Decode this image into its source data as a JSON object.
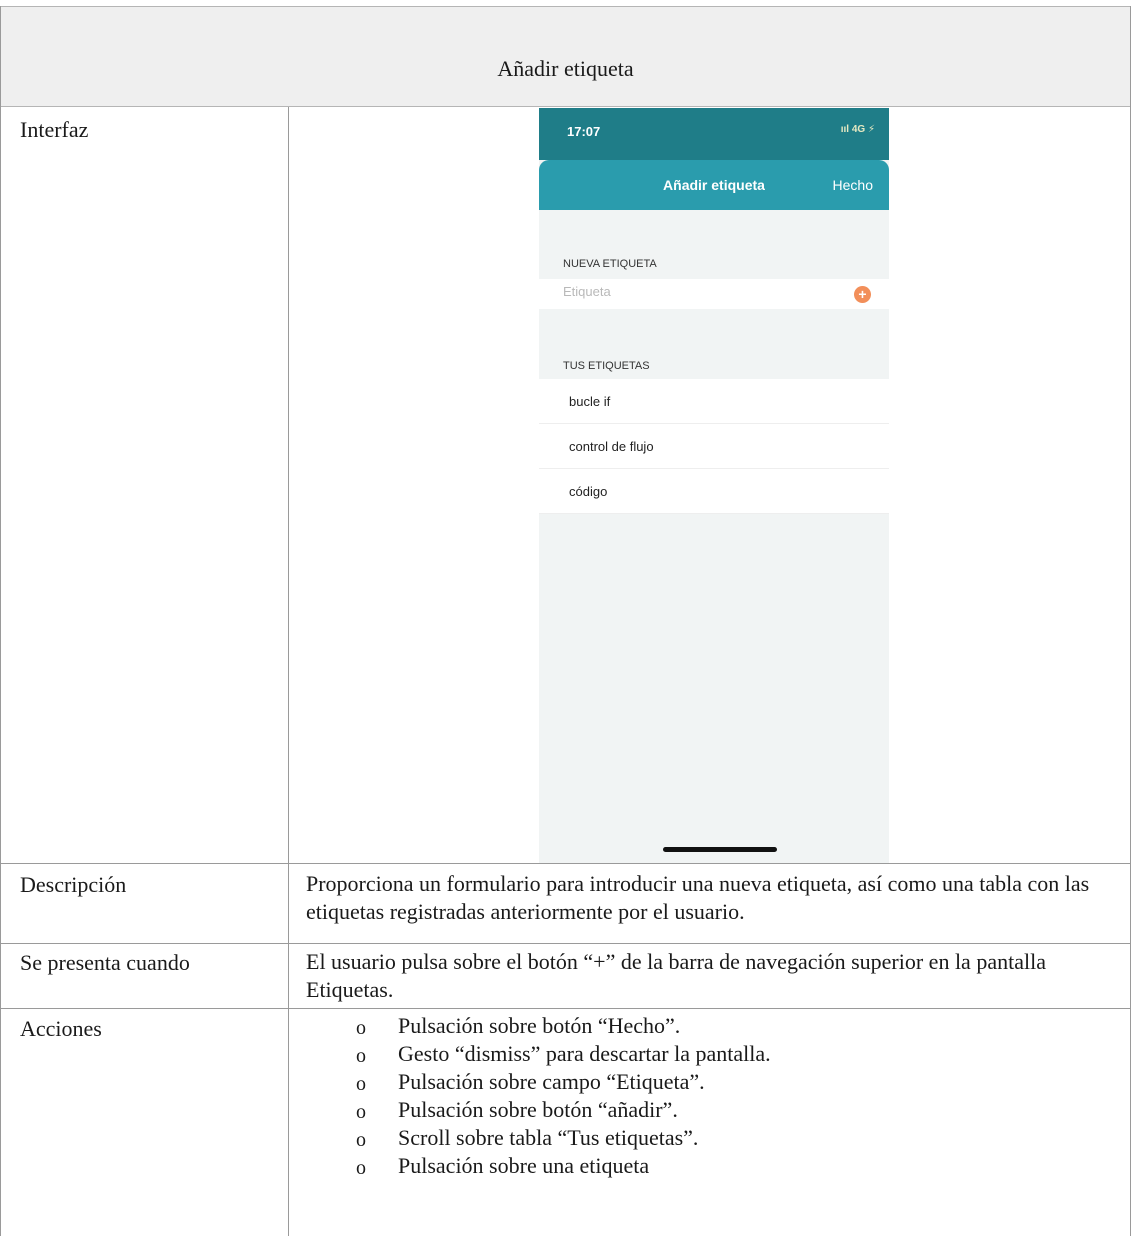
{
  "header": {
    "title": "Añadir etiqueta"
  },
  "rows": {
    "interfaz_label": "Interfaz",
    "descripcion_label": "Descripción",
    "descripcion_text": "Proporciona un formulario para introducir una nueva etiqueta, así como una tabla con las etiquetas registradas anteriormente por el usuario.",
    "se_presenta_label": "Se presenta cuando",
    "se_presenta_text": "El usuario pulsa sobre el botón “+” de la barra de navegación superior en la pantalla Etiquetas.",
    "acciones_label": "Acciones",
    "bullet_symbol": "o",
    "acciones": [
      "Pulsación sobre botón “Hecho”.",
      "Gesto “dismiss” para descartar la pantalla.",
      "Pulsación sobre campo “Etiqueta”.",
      "Pulsación sobre botón “añadir”.",
      "Scroll sobre tabla “Tus etiquetas”.",
      "Pulsación sobre una etiqueta"
    ]
  },
  "phone": {
    "status_time": "17:07",
    "status_right": "ııl 4G ⚡",
    "nav_title": "Añadir etiqueta",
    "nav_done": "Hecho",
    "new_section_label": "NUEVA ETIQUETA",
    "field_placeholder": "Etiqueta",
    "add_symbol": "+",
    "tags_section_label": "TUS ETIQUETAS",
    "tags": [
      "bucle if",
      "control de flujo",
      "código"
    ],
    "colors": {
      "status_bar": "#1f7d88",
      "nav_bar": "#2a9cad",
      "add_button": "#f28f5a",
      "background": "#f1f4f4"
    }
  }
}
